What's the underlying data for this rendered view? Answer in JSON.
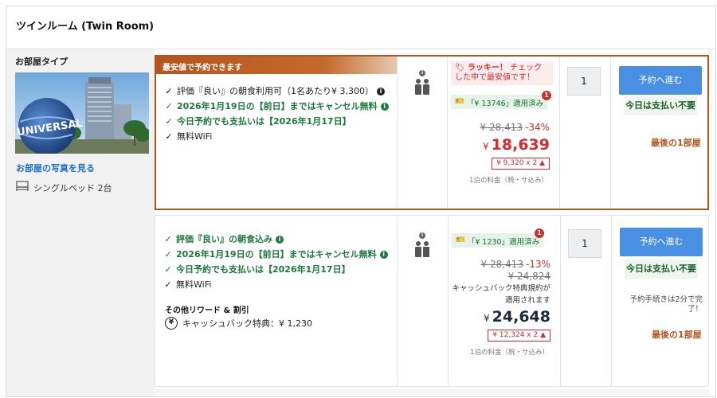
{
  "room": {
    "title": "ツインルーム (Twin Room)",
    "type_label": "お部屋タイプ",
    "photo_link": "お部屋の写真を見る",
    "bed": "シングルベッド 2台",
    "photo_sign": "UNIVERSAL"
  },
  "offers": [
    {
      "banner": "最安値で予約できます",
      "benefits": [
        {
          "text": "評価『良い』の朝食利用可（1名あたり¥ 3,300）",
          "green": false,
          "info": true
        },
        {
          "text": "2026年1月19日の【前日】まではキャンセル無料",
          "green": true,
          "info": true
        },
        {
          "text": "今日予約でも支払いは【2026年1月17日】",
          "green": true,
          "info": false
        },
        {
          "text": "無料WiFi",
          "green": false,
          "info": false
        }
      ],
      "lucky_title": "ラッキー！",
      "lucky_text": "チェックした中で最安値です！",
      "coupon": "「¥ 13746」適用済み",
      "coupon_badge": "1",
      "original_price": "¥ 28,413",
      "discount": "-34%",
      "currency": "¥",
      "price": "18,639",
      "per_night": "¥ 9,320 x 2",
      "tax_note": "1泊の料金（税・サ込み）",
      "quantity": "1",
      "button": "予約へ進む",
      "pay_now": "今日は支払い不要",
      "last_room": "最後の1部屋"
    },
    {
      "benefits": [
        {
          "text": "評価『良い』の朝食込み",
          "green": true,
          "info": true
        },
        {
          "text": "2026年1月19日の【前日】まではキャンセル無料",
          "green": true,
          "info": true
        },
        {
          "text": "今日予約でも支払いは【2026年1月17日】",
          "green": true,
          "info": false
        },
        {
          "text": "無料WiFi",
          "green": false,
          "info": false
        }
      ],
      "rewards_title": "その他リワード & 割引",
      "cashback": "キャッシュバック特典：¥ 1,230",
      "coupon": "「¥ 1230」適用済み",
      "coupon_badge": "1",
      "original_price": "¥ 28,413",
      "discount": "-13%",
      "mid_price": "¥ 24,824",
      "cashback_note": "キャッシュバック特典規約が適用されます",
      "currency": "¥",
      "price": "24,648",
      "per_night": "¥ 12,324 x 2",
      "tax_note": "1泊の料金（税・サ込み）",
      "quantity": "1",
      "button": "予約へ進む",
      "pay_now": "今日は支払い不要",
      "complete_note": "予約手続きは2分で完了！",
      "last_room": "最後の1部屋"
    }
  ],
  "colors": {
    "accent": "#b5541c",
    "button": "#4a90e2",
    "green": "#1b7a3a",
    "red": "#d92b2b"
  },
  "icons": {
    "info": "info-icon",
    "check": "check-icon",
    "occupancy": "person-icon",
    "bed": "bed-icon",
    "ticket": "ticket-icon",
    "tag": "tag-icon",
    "cashback": "cashback-icon"
  }
}
